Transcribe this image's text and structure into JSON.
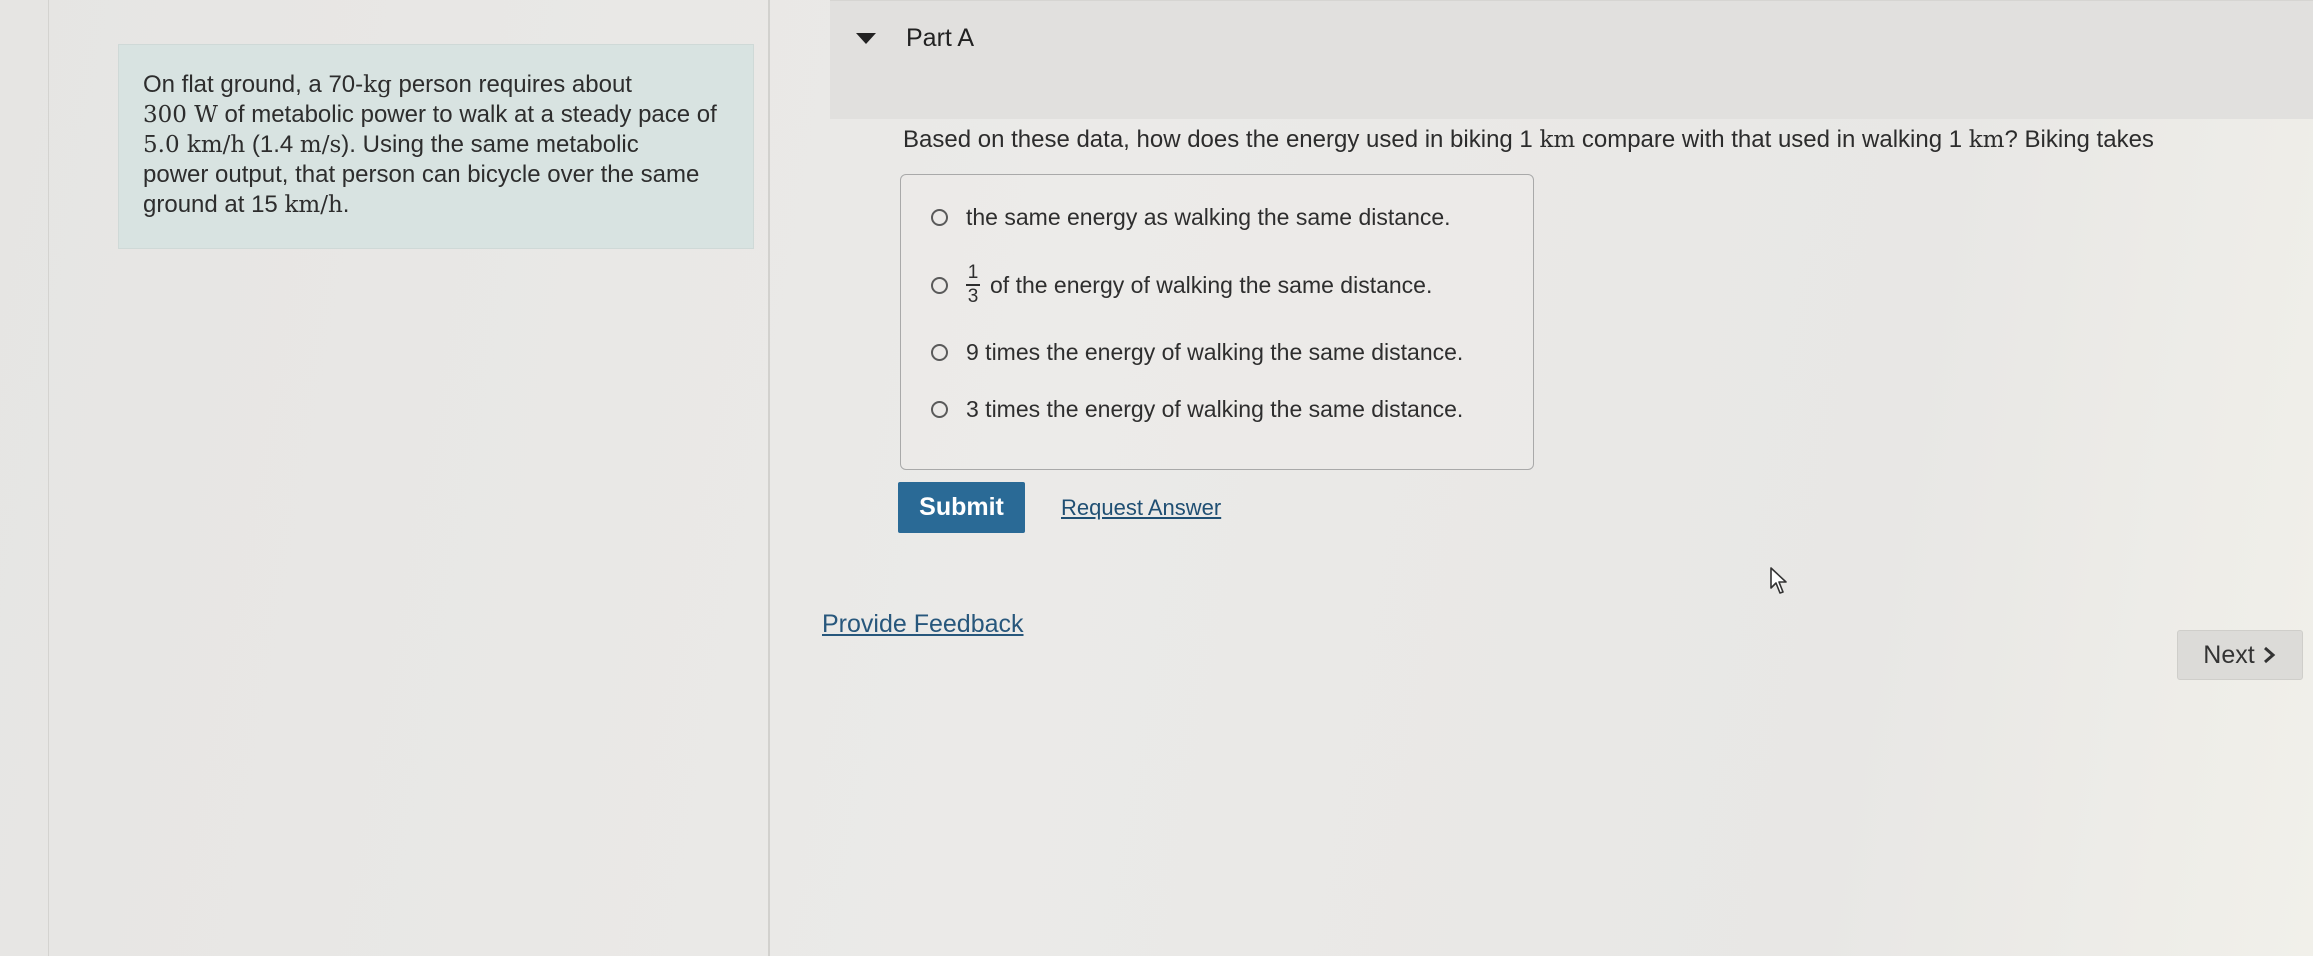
{
  "problem": {
    "line1_pre": "On flat ground, a 70-",
    "line1_unit": "kg",
    "line1_post": " person requires about",
    "line2_val": "300 W",
    "line2_post": " of metabolic power to walk at a steady pace of",
    "line3_val": "5.0 km/h",
    "line3_mid": " (1.4 ",
    "line3_unit": "m/s",
    "line3_post": "). Using the same metabolic",
    "line4": "power output, that person can bicycle over the same",
    "line5_pre": "ground at 15 ",
    "line5_unit": "km/h",
    "line5_post": "."
  },
  "part": {
    "title": "Part A"
  },
  "question": {
    "pre": "Based on these data, how does the energy used in biking 1 ",
    "unit1": "km",
    "mid": " compare with that used in walking 1 ",
    "unit2": "km",
    "post": "? Biking takes"
  },
  "options": [
    {
      "text": "the same energy as walking the same distance."
    },
    {
      "frac_num": "1",
      "frac_den": "3",
      "text": "of the energy of walking the same distance."
    },
    {
      "text": "9 times the energy of walking the same distance."
    },
    {
      "text": "3 times the energy of walking the same distance."
    }
  ],
  "actions": {
    "submit": "Submit",
    "request_answer": "Request Answer",
    "provide_feedback": "Provide Feedback",
    "next": "Next"
  },
  "colors": {
    "submit_bg": "#2a6a96",
    "problem_bg": "#d8e3e1",
    "link": "#1f4f73"
  }
}
